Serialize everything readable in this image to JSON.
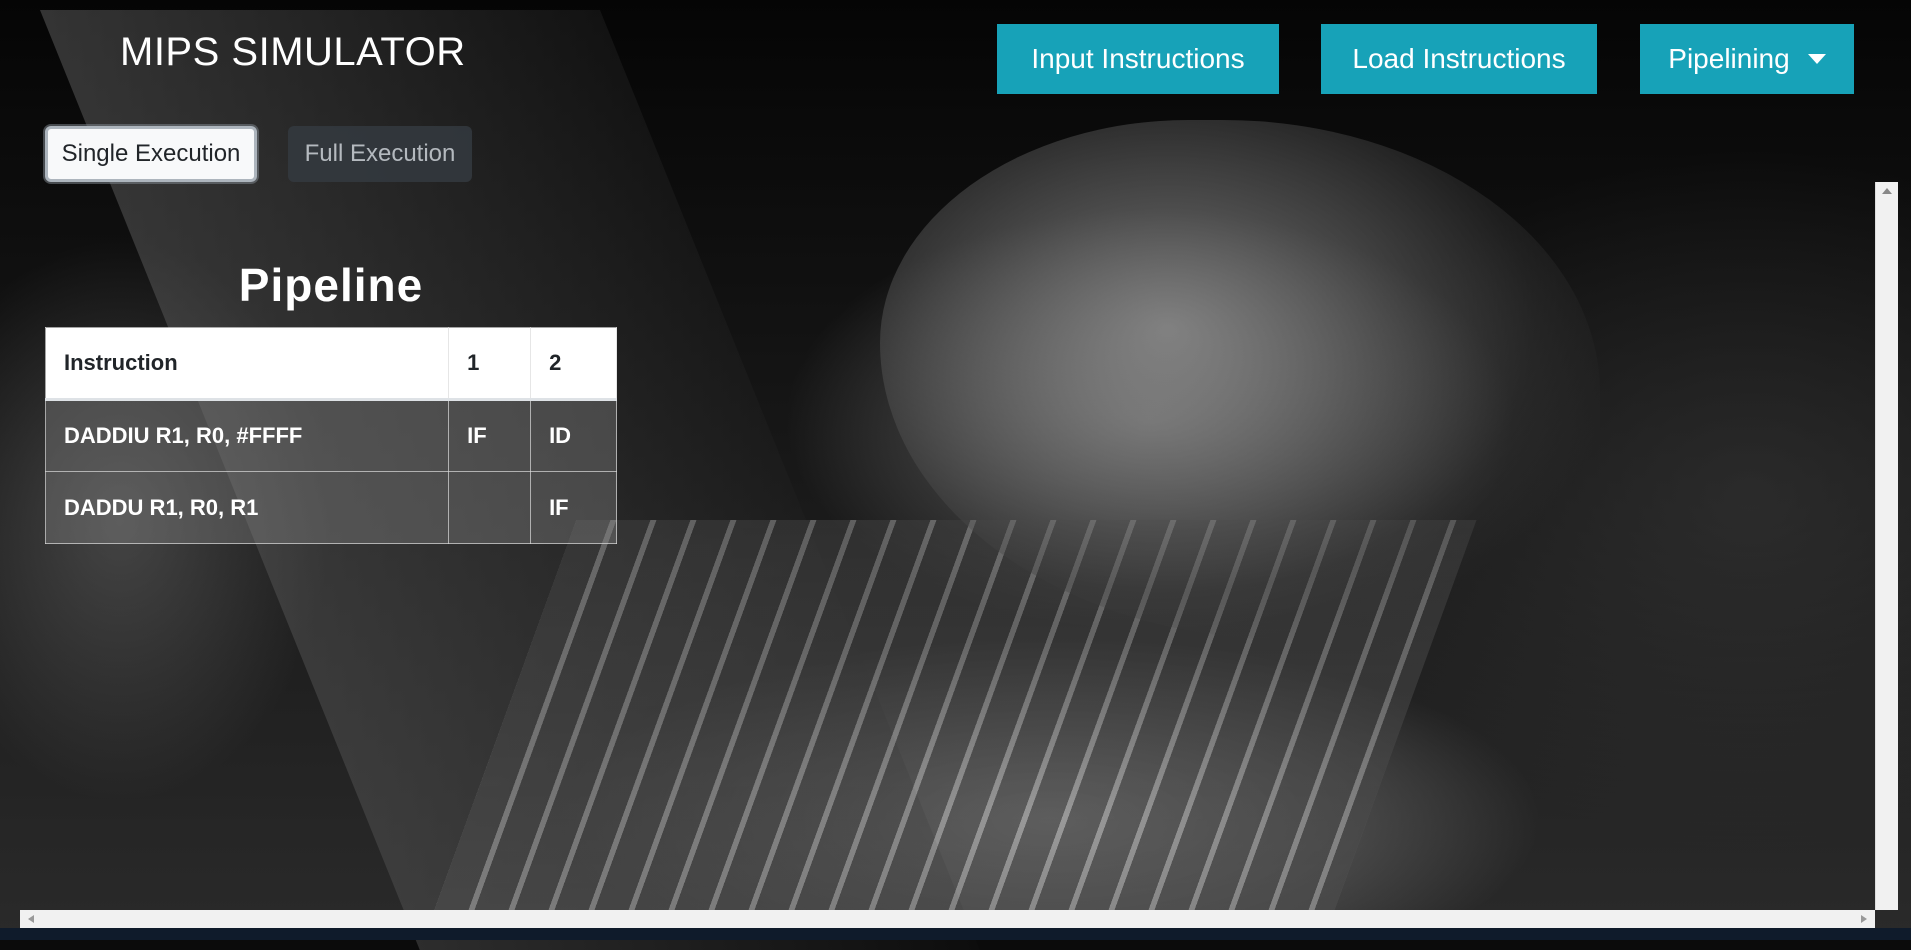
{
  "app": {
    "brand": "MIPS SIMULATOR"
  },
  "nav": {
    "input_label": "Input Instructions",
    "load_label": "Load Instructions",
    "pipelining_label": "Pipelining"
  },
  "execution": {
    "single_label": "Single Execution",
    "full_label": "Full Execution",
    "selected": "Single Execution"
  },
  "pipeline": {
    "title": "Pipeline",
    "columns": [
      "Instruction",
      "1",
      "2"
    ],
    "rows": [
      {
        "instruction": "DADDIU R1, R0, #FFFF",
        "c1": "IF",
        "c2": "ID"
      },
      {
        "instruction": "DADDU R1, R0, R1",
        "c1": "",
        "c2": "IF"
      }
    ]
  },
  "colors": {
    "accent": "#17a2b8",
    "dark_button": "#343a40",
    "light_button": "#f8f9fa"
  },
  "icons": {
    "dropdown": "caret-down-icon"
  }
}
